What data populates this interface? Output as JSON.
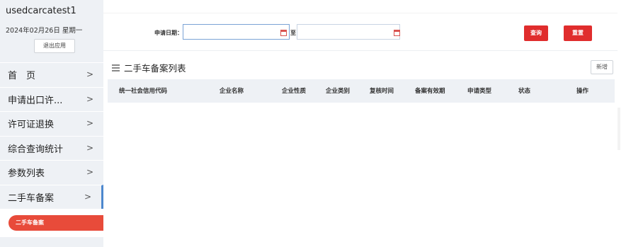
{
  "user": {
    "name": "usedcarcatest1",
    "date": "2024年02月26日 星期一",
    "logout_label": "退出应用"
  },
  "sidebar": {
    "items": [
      {
        "label": "首　页"
      },
      {
        "label": "申请出口许..."
      },
      {
        "label": "许可证退换"
      },
      {
        "label": "综合查询统计"
      },
      {
        "label": "参数列表"
      },
      {
        "label": "二手车备案"
      }
    ],
    "chevron": ">",
    "submenu_active": "二手车备案"
  },
  "search": {
    "date_label": "申请日期：",
    "date_from": "",
    "to_label": "至",
    "date_to": "",
    "query_label": "查询",
    "reset_label": "重置"
  },
  "list": {
    "title": "二手车备案列表",
    "new_label": "新增",
    "columns": [
      "统一社会信用代码",
      "企业名称",
      "企业性质",
      "企业类别",
      "复核时间",
      "备案有效期",
      "申请类型",
      "状态",
      "操作"
    ],
    "rows": []
  },
  "colors": {
    "accent_red": "#e02d2d",
    "sidebar_bg": "#eef1f5",
    "active_bar": "#4d88ce"
  }
}
